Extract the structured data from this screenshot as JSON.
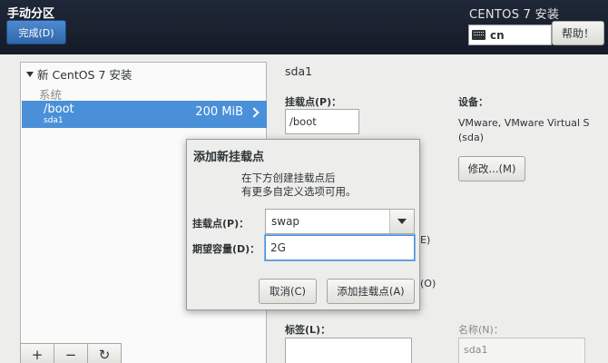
{
  "header": {
    "title": "手动分区",
    "done_button": "完成(D)",
    "product_title": "CENTOS 7 安装",
    "keyboard_layout": "cn",
    "help_button": "帮助！"
  },
  "left_panel": {
    "os_group": "新 CentOS 7 安装",
    "section_label": "系统",
    "mount_points": [
      {
        "name": "/boot",
        "device": "sda1",
        "size": "200 MiB"
      }
    ],
    "buttons": {
      "add": "+",
      "remove": "−",
      "refresh": "↻"
    }
  },
  "detail_panel": {
    "title": "sda1",
    "mount_point_label": "挂载点(P)：",
    "mount_point_value": "/boot",
    "device_label": "设备：",
    "device_description": "VMware, VMware Virtual S (sda)",
    "modify_button": "修改...(M)",
    "partial_e": "E)",
    "partial_o": "(O)",
    "label_label": "标签(L)：",
    "label_value": "",
    "name_label": "名称(N)：",
    "name_value": "sda1"
  },
  "dialog": {
    "title": "添加新挂载点",
    "description_line1": "在下方创建挂载点后",
    "description_line2": "有更多自定义选项可用。",
    "mount_point_label": "挂载点(P)：",
    "mount_point_value": "swap",
    "capacity_label": "期望容量(D)：",
    "capacity_value": "2G",
    "cancel_button": "取消(C)",
    "add_button": "添加挂载点(A)"
  }
}
